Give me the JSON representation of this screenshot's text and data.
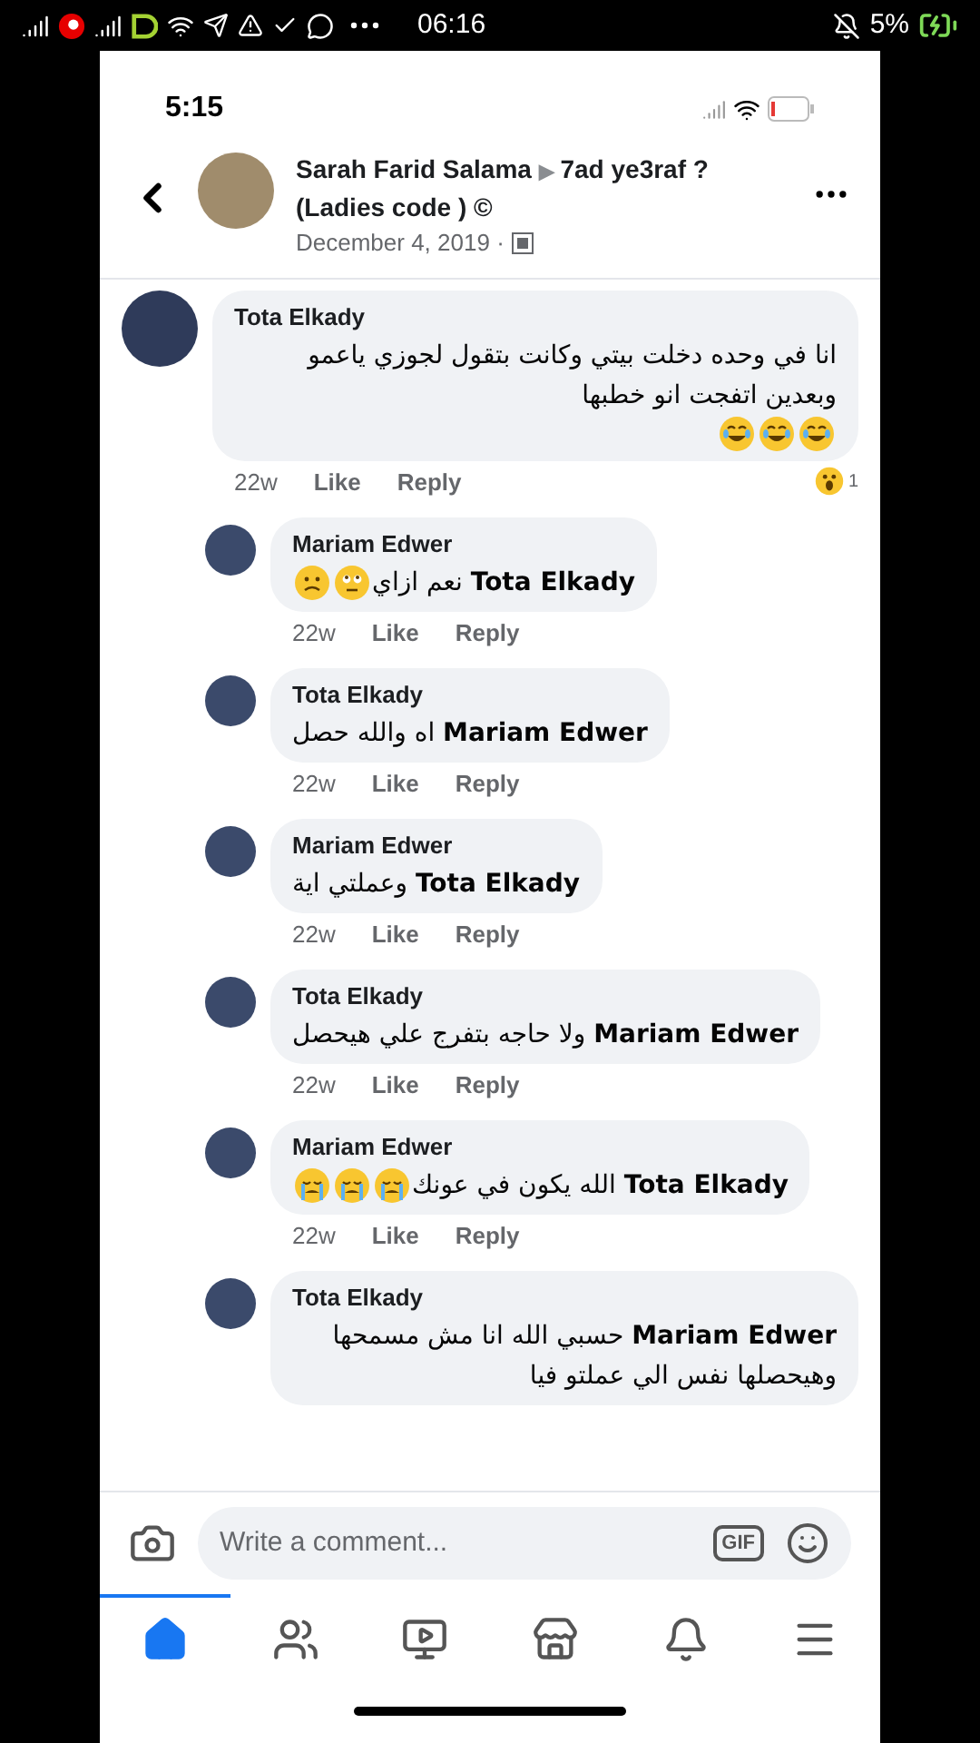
{
  "device_status": {
    "time": "06:16",
    "battery": "5%"
  },
  "phone_status": {
    "time": "5:15"
  },
  "header": {
    "author": "Sarah Farid Salama",
    "separator": "▶",
    "group": "7ad ye3raf ? (Ladies code ) ©",
    "date": "December 4, 2019 ·"
  },
  "comments": [
    {
      "author": "Tota Elkady",
      "text": "انا في وحده دخلت بيتي وكانت بتقول لجوزي ياعمو وبعدين اتفجت انو خطبها",
      "emojis": [
        {
          "kind": "laugh"
        },
        {
          "kind": "laugh"
        },
        {
          "kind": "laugh"
        }
      ],
      "age": "22w",
      "like": "Like",
      "reply": "Reply",
      "reaction": {
        "count": "1"
      },
      "children": [
        {
          "author": "Mariam Edwer",
          "text": "**Tota Elkady** نعم ازاي",
          "emojis": [
            {
              "kind": "eyeroll"
            },
            {
              "kind": "frown"
            }
          ],
          "age": "22w",
          "like": "Like",
          "reply": "Reply"
        },
        {
          "author": "Tota Elkady",
          "text": "**Mariam Edwer** اه والله حصل",
          "age": "22w",
          "like": "Like",
          "reply": "Reply"
        },
        {
          "author": "Mariam Edwer",
          "text": "**Tota Elkady** وعملتي اية",
          "age": "22w",
          "like": "Like",
          "reply": "Reply"
        },
        {
          "author": "Tota Elkady",
          "text": "**Mariam Edwer** ولا حاجه بتفرج علي هيحصل",
          "age": "22w",
          "like": "Like",
          "reply": "Reply"
        },
        {
          "author": "Mariam Edwer",
          "text": "**Tota Elkady** الله يكون في عونك",
          "emojis": [
            {
              "kind": "sob"
            },
            {
              "kind": "sob"
            },
            {
              "kind": "sob"
            }
          ],
          "age": "22w",
          "like": "Like",
          "reply": "Reply"
        },
        {
          "author": "Tota Elkady",
          "text": "**Mariam Edwer** حسبي الله انا مش مسمحها وهيحصلها نفس الي عملتو فيا"
        }
      ]
    }
  ],
  "composer": {
    "placeholder": "Write a comment...",
    "gif": "GIF"
  },
  "nav": [
    {
      "kind": "home",
      "selected": true
    },
    {
      "kind": "friends",
      "selected": false
    },
    {
      "kind": "video",
      "selected": false
    },
    {
      "kind": "market",
      "selected": false
    },
    {
      "kind": "bell",
      "selected": false
    },
    {
      "kind": "menu",
      "selected": false
    }
  ]
}
